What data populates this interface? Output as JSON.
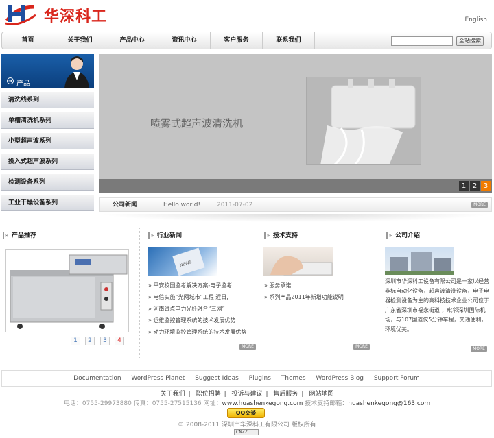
{
  "header": {
    "logo_text": "华深科工",
    "lang_link": "English"
  },
  "nav": {
    "items": [
      "首页",
      "关于我们",
      "产品中心",
      "资讯中心",
      "客户服务",
      "联系我们"
    ],
    "search_placeholder": "",
    "search_button": "全站搜索"
  },
  "sidebar": {
    "head_label": "产品",
    "items": [
      "清洗线系列",
      "单槽清洗机系列",
      "小型超声波系列",
      "投入式超声波系列",
      "检测设备系列",
      "工业干燥设备系列"
    ]
  },
  "banner": {
    "title": "喷雾式超声波清洗机",
    "pages": [
      "1",
      "2",
      "3"
    ],
    "active_page": "3"
  },
  "news_strip": {
    "label": "公司新闻",
    "headline": "Hello world!",
    "date": "2011-07-02",
    "more": "MORE"
  },
  "columns": {
    "products": {
      "title": "产品推荐",
      "thumbs": [
        "1",
        "2",
        "3",
        "4"
      ]
    },
    "industry": {
      "title": "行业新闻",
      "items": [
        "平安校园监考解决方案-电子监考",
        "电信实施“光网城市”工程 近日,",
        "河南试点电力光纤融合“三网”",
        "运维监控管理系统的技术发展优势",
        "动力环境监控管理系统的技术发展优势"
      ],
      "more": "MORE"
    },
    "support": {
      "title": "技术支持",
      "items": [
        "服务承诺",
        "系列产品2011年新增功能说明"
      ],
      "more": "MORE"
    },
    "about": {
      "title": "公司介绍",
      "text": "深圳市华深科工设备有限公司是一家以经营非标自动化设备，超声波清洗设备，电子电器检测设备为主的高科技技术企业公司位于广东省深圳市福永街道 ，毗邻深圳国际机场，与107国道仅5分钟车程，交通便利，环境优美。",
      "more": "MORE"
    }
  },
  "footer": {
    "wp_links": [
      "Documentation",
      "WordPress Planet",
      "Suggest Ideas",
      "Plugins",
      "Themes",
      "WordPress Blog",
      "Support Forum"
    ],
    "links": [
      "关于我们",
      "职位招聘",
      "投诉与建议",
      "售后服务",
      "网站地图"
    ],
    "contact_prefix": "电话：0755-29973880 传真：0755-27515136 网址：",
    "contact_site": "www.huashenkegong.com",
    "contact_mid": " 技术支持邮箱：",
    "contact_email": "huashenkegong@163.com",
    "qq_label": "QQ交谈",
    "copyright": "© 2008-2011 深圳市华深科工有限公司 版权所有",
    "cnzz": "CNZZ"
  },
  "colors": {
    "brand_red": "#d9261c",
    "sidebar_blue": "#0b3e7c",
    "pager_active": "#f07b00"
  }
}
